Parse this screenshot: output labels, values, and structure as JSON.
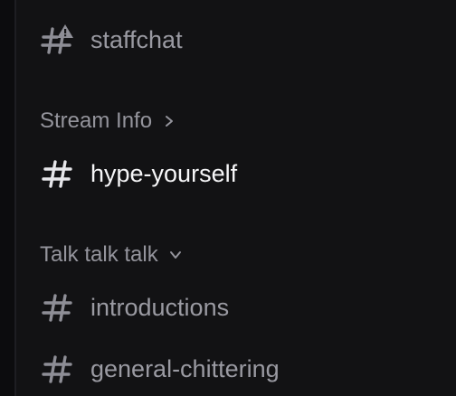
{
  "channels_top": [
    {
      "label": "staffchat",
      "icon": "hashtag-locked-icon",
      "state": "muted"
    }
  ],
  "categories": [
    {
      "label": "Stream Info",
      "chevron": "chevron-right-icon",
      "expanded": false,
      "channels": [
        {
          "label": "hype-yourself",
          "icon": "hashtag-icon",
          "state": "active"
        }
      ]
    },
    {
      "label": "Talk talk talk",
      "chevron": "chevron-down-icon",
      "expanded": true,
      "channels": [
        {
          "label": "introductions",
          "icon": "hashtag-icon",
          "state": "muted"
        },
        {
          "label": "general-chittering",
          "icon": "hashtag-icon",
          "state": "muted"
        }
      ]
    }
  ],
  "colors": {
    "background": "#121214",
    "muted_text": "#9a9aa2",
    "active_text": "#f6f6f8"
  }
}
